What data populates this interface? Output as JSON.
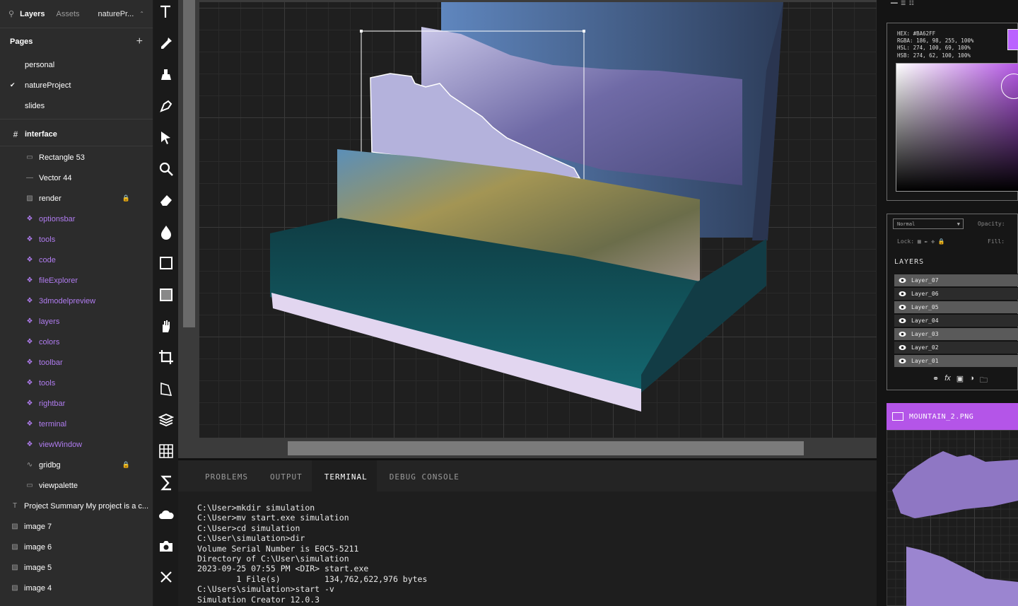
{
  "left_panel": {
    "tabs": {
      "layers": "Layers",
      "assets": "Assets"
    },
    "project_name": "naturePr...",
    "pages_heading": "Pages",
    "pages": [
      "personal",
      "natureProject",
      "slides"
    ],
    "frame": "interface",
    "layers": [
      {
        "label": "Rectangle 53",
        "icon": "rectangle-icon",
        "kind": "shape"
      },
      {
        "label": "Vector 44",
        "icon": "vector-icon",
        "kind": "shape"
      },
      {
        "label": "render",
        "icon": "image-icon",
        "kind": "shape",
        "locked": true
      },
      {
        "label": "optionsbar",
        "icon": "component-icon",
        "kind": "component"
      },
      {
        "label": "tools",
        "icon": "component-icon",
        "kind": "component"
      },
      {
        "label": "code",
        "icon": "component-icon",
        "kind": "component"
      },
      {
        "label": "fileExplorer",
        "icon": "component-icon",
        "kind": "component"
      },
      {
        "label": "3dmodelpreview",
        "icon": "component-icon",
        "kind": "component"
      },
      {
        "label": "layers",
        "icon": "component-icon",
        "kind": "component"
      },
      {
        "label": "colors",
        "icon": "component-icon",
        "kind": "component"
      },
      {
        "label": "toolbar",
        "icon": "component-icon",
        "kind": "component"
      },
      {
        "label": "tools",
        "icon": "component-icon",
        "kind": "component"
      },
      {
        "label": "rightbar",
        "icon": "component-icon",
        "kind": "component"
      },
      {
        "label": "terminal",
        "icon": "component-icon",
        "kind": "component"
      },
      {
        "label": "viewWindow",
        "icon": "component-icon",
        "kind": "component"
      },
      {
        "label": "gridbg",
        "icon": "pen-vector-icon",
        "kind": "shape",
        "locked": true
      },
      {
        "label": "viewpalette",
        "icon": "rectangle-icon",
        "kind": "shape"
      }
    ],
    "top_layers": [
      {
        "label": "Project Summary My project is a c...",
        "icon": "text-icon"
      },
      {
        "label": "image 7",
        "icon": "image-icon"
      },
      {
        "label": "image 6",
        "icon": "image-icon"
      },
      {
        "label": "image 5",
        "icon": "image-icon"
      },
      {
        "label": "image 4",
        "icon": "image-icon"
      }
    ]
  },
  "terminal": {
    "tabs": [
      "PROBLEMS",
      "OUTPUT",
      "TERMINAL",
      "DEBUG CONSOLE"
    ],
    "active_tab": "TERMINAL",
    "lines": [
      "C:\\User>mkdir simulation",
      "C:\\User>mv start.exe simulation",
      "C:\\User>cd simulation",
      "C:\\User\\simulation>dir",
      "Volume Serial Number is E0C5-5211",
      "Directory of C:\\User\\simulation",
      "2023-09-25 07:55 PM <DIR> start.exe",
      "        1 File(s)         134,762,622,976 bytes",
      "C:\\Users\\simulation>start -v",
      "Simulation Creator 12.0.3"
    ]
  },
  "color_panel": {
    "hex": "HEX: #BA62FF",
    "rgba": "RGBA: 186, 98, 255, 100%",
    "hsl": "HSL: 274, 100, 69, 100%",
    "hsb": "HSB: 274, 62, 100, 100%",
    "current_color": "#BA62FF"
  },
  "layers_panel": {
    "blend_mode": "Normal",
    "opacity_label": "Opacity:",
    "lock_label": "Lock:",
    "fill_label": "Fill:",
    "heading": "LAYERS",
    "layers": [
      "Layer_07",
      "Layer_06",
      "Layer_05",
      "Layer_04",
      "Layer_03",
      "Layer_02",
      "Layer_01"
    ],
    "selected": [
      "Layer_07",
      "Layer_05",
      "Layer_03",
      "Layer_01"
    ]
  },
  "image_panel": {
    "title": "MOUNTAIN_2.PNG",
    "accent": "#B455E8"
  }
}
